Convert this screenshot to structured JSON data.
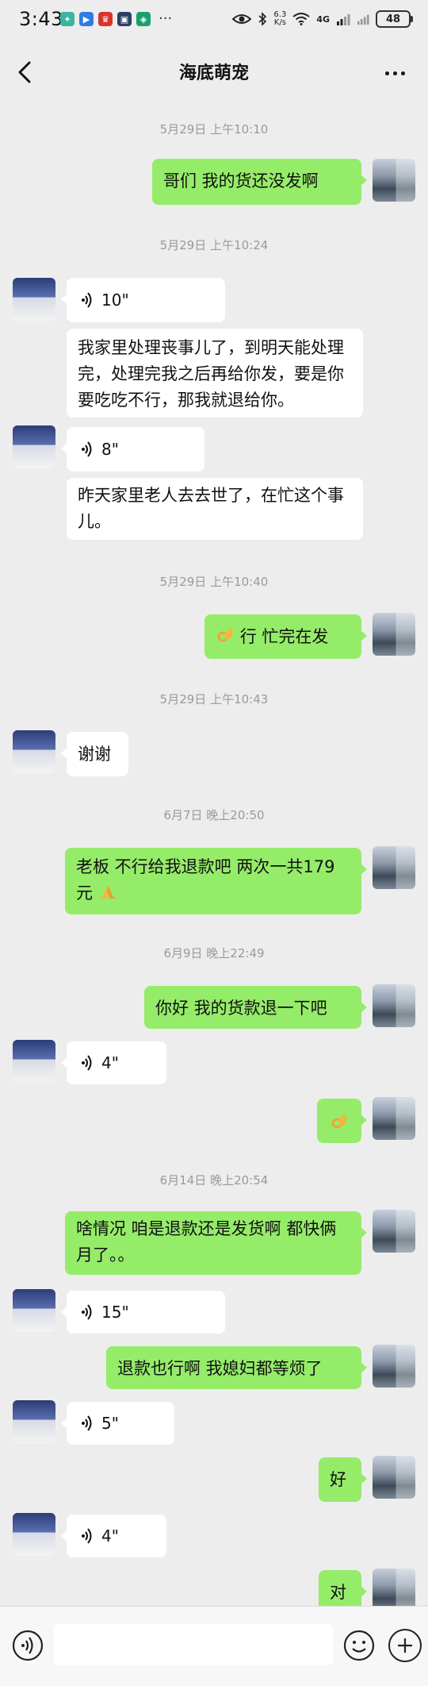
{
  "status_bar": {
    "time": "3:43",
    "more": "···",
    "net_speed_value": "6.3",
    "net_speed_unit": "K/s",
    "network": "4G",
    "battery": "48"
  },
  "header": {
    "title": "海底萌宠"
  },
  "messages": [
    {
      "kind": "time",
      "text": "5月29日 上午10:10"
    },
    {
      "kind": "text",
      "from": "me",
      "text": "哥们  我的货还没发啊"
    },
    {
      "kind": "time",
      "text": "5月29日 上午10:24"
    },
    {
      "kind": "voice",
      "from": "them",
      "duration": "10\""
    },
    {
      "kind": "text",
      "from": "them",
      "text": "我家里处理丧事儿了，到明天能处理完，处理完我之后再给你发，要是你要吃吃不行，那我就退给你。"
    },
    {
      "kind": "voice",
      "from": "them",
      "duration": "8\""
    },
    {
      "kind": "text",
      "from": "them",
      "text": "昨天家里老人去去世了，在忙这个事儿。"
    },
    {
      "kind": "time",
      "text": "5月29日 上午10:40"
    },
    {
      "kind": "text",
      "from": "me",
      "text": "行  忙完在发"
    },
    {
      "kind": "time",
      "text": "5月29日 上午10:43"
    },
    {
      "kind": "text",
      "from": "them",
      "text": "谢谢"
    },
    {
      "kind": "time",
      "text": "6月7日 晚上20:50"
    },
    {
      "kind": "text",
      "from": "me",
      "text": "老板   不行给我退款吧  两次一共179元"
    },
    {
      "kind": "time",
      "text": "6月9日 晚上22:49"
    },
    {
      "kind": "text",
      "from": "me",
      "text": "你好  我的货款退一下吧"
    },
    {
      "kind": "voice",
      "from": "them",
      "duration": "4\""
    },
    {
      "kind": "emoji",
      "from": "me"
    },
    {
      "kind": "time",
      "text": "6月14日 晚上20:54"
    },
    {
      "kind": "text",
      "from": "me",
      "text": "啥情况   咱是退款还是发货啊  都快俩月了。。"
    },
    {
      "kind": "voice",
      "from": "them",
      "duration": "15\""
    },
    {
      "kind": "text",
      "from": "me",
      "text": "退款也行啊   我媳妇都等烦了"
    },
    {
      "kind": "voice",
      "from": "them",
      "duration": "5\""
    },
    {
      "kind": "text",
      "from": "me",
      "text": "好"
    },
    {
      "kind": "voice",
      "from": "them",
      "duration": "4\""
    },
    {
      "kind": "text",
      "from": "me",
      "text": "对"
    }
  ],
  "input_bar": {
    "placeholder": ""
  },
  "icons": {
    "back": "back-arrow-icon",
    "more": "more-dots-icon",
    "voice_toggle": "voice-toggle-icon",
    "emoji": "emoji-icon",
    "plus": "plus-icon",
    "wave": "voice-wave-icon",
    "ok_hand": "ok-hand-emoji",
    "pray": "pray-emoji"
  },
  "colors": {
    "background": "#ededed",
    "bubble_self": "#95ec69",
    "bubble_other": "#ffffff",
    "timestamp": "#9a9a9a"
  }
}
